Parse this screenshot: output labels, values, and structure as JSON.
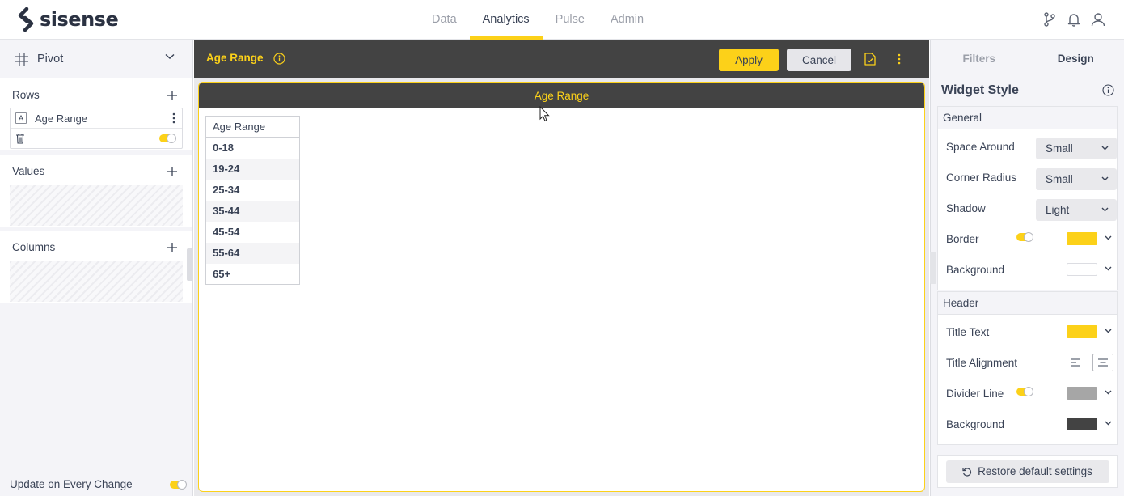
{
  "brand": {
    "name": "sisense",
    "accent": "#fcd119",
    "dark": "#434343"
  },
  "nav": {
    "tabs": [
      {
        "label": "Data"
      },
      {
        "label": "Analytics",
        "active": true
      },
      {
        "label": "Pulse"
      },
      {
        "label": "Admin"
      }
    ],
    "icons": [
      "branch-icon",
      "bell-icon",
      "user-icon"
    ]
  },
  "left": {
    "widget_type": "Pivot",
    "rows": {
      "title": "Rows",
      "fields": [
        {
          "type_badge": "A",
          "name": "Age Range"
        }
      ]
    },
    "values": {
      "title": "Values"
    },
    "columns": {
      "title": "Columns"
    },
    "update_label": "Update on Every Change"
  },
  "toolbar": {
    "title": "Age Range",
    "apply_label": "Apply",
    "cancel_label": "Cancel"
  },
  "widget": {
    "title": "Age Range",
    "table": {
      "header": "Age Range",
      "rows": [
        "0-18",
        "19-24",
        "25-34",
        "35-44",
        "45-54",
        "55-64",
        "65+"
      ]
    }
  },
  "right": {
    "tabs": [
      {
        "label": "Filters"
      },
      {
        "label": "Design",
        "active": true
      }
    ],
    "section_title": "Widget Style",
    "general": {
      "title": "General",
      "space_around": {
        "label": "Space Around",
        "value": "Small"
      },
      "corner_radius": {
        "label": "Corner Radius",
        "value": "Small"
      },
      "shadow": {
        "label": "Shadow",
        "value": "Light"
      },
      "border": {
        "label": "Border",
        "color": "#fcd119"
      },
      "background": {
        "label": "Background",
        "color": "#ffffff"
      }
    },
    "header": {
      "title": "Header",
      "title_text": {
        "label": "Title Text",
        "color": "#fcd119"
      },
      "title_alignment": {
        "label": "Title Alignment",
        "value": "center"
      },
      "divider_line": {
        "label": "Divider Line",
        "color": "#a6a6a6"
      },
      "background": {
        "label": "Background",
        "color": "#434343"
      }
    },
    "restore_label": "Restore default settings"
  }
}
